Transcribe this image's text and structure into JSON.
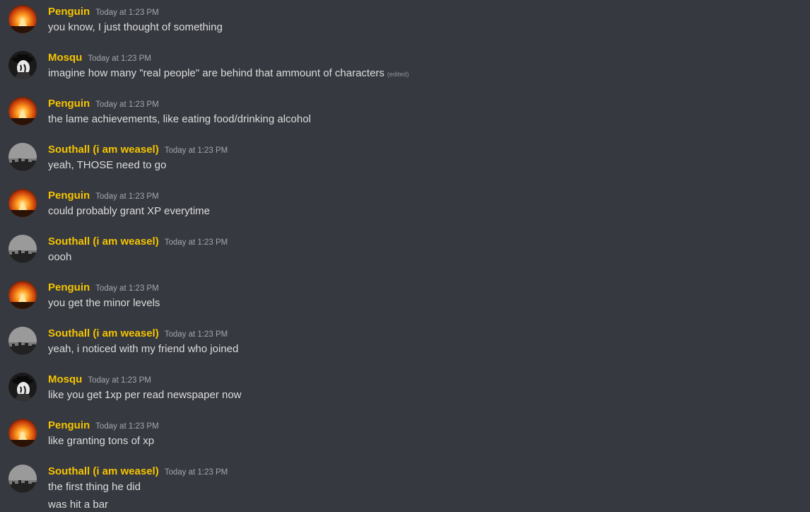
{
  "messages": [
    {
      "user": "Penguin",
      "time": "Today at 1:23 PM",
      "text": "you know, I just thought of something",
      "avatar": "penguin-avatar-icon"
    },
    {
      "user": "Mosqu",
      "time": "Today at 1:23 PM",
      "text": "imagine how many \"real people\" are behind that ammount of characters",
      "edited": "(edited)",
      "avatar": "mosqu-avatar-icon"
    },
    {
      "user": "Penguin",
      "time": "Today at 1:23 PM",
      "text": "the lame achievements, like eating food/drinking alcohol",
      "avatar": "penguin-avatar-icon"
    },
    {
      "user": "Southall (i am weasel)",
      "time": "Today at 1:23 PM",
      "text": "yeah, THOSE need to go",
      "avatar": "southall-avatar-icon"
    },
    {
      "user": "Penguin",
      "time": "Today at 1:23 PM",
      "text": "could probably grant XP everytime",
      "avatar": "penguin-avatar-icon"
    },
    {
      "user": "Southall (i am weasel)",
      "time": "Today at 1:23 PM",
      "text": "oooh",
      "avatar": "southall-avatar-icon"
    },
    {
      "user": "Penguin",
      "time": "Today at 1:23 PM",
      "text": "you get the minor levels",
      "avatar": "penguin-avatar-icon"
    },
    {
      "user": "Southall (i am weasel)",
      "time": "Today at 1:23 PM",
      "text": "yeah, i noticed with my friend who joined",
      "avatar": "southall-avatar-icon"
    },
    {
      "user": "Mosqu",
      "time": "Today at 1:23 PM",
      "text": "like you get 1xp per read newspaper now",
      "avatar": "mosqu-avatar-icon"
    },
    {
      "user": "Penguin",
      "time": "Today at 1:23 PM",
      "text": "like granting tons of xp",
      "avatar": "penguin-avatar-icon"
    },
    {
      "user": "Southall (i am weasel)",
      "time": "Today at 1:23 PM",
      "text": "the first thing he did",
      "text2": "was hit a bar",
      "avatar": "southall-avatar-icon"
    }
  ],
  "colors": {
    "background": "#36393f",
    "username": "#f5c400",
    "text": "#dcddde",
    "timestamp": "#a3a6aa"
  }
}
